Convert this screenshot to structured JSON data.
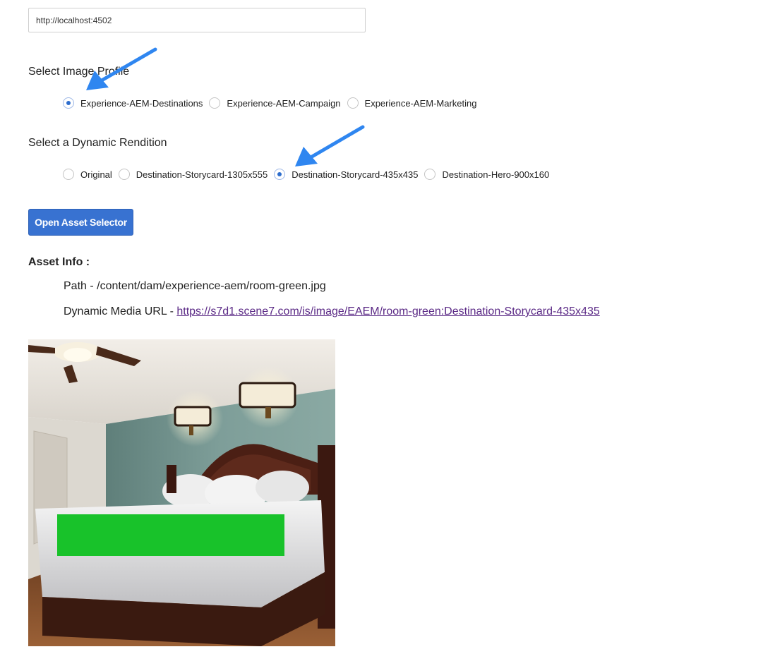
{
  "server": {
    "url_value": "http://localhost:4502"
  },
  "image_profile": {
    "label": "Select Image Profile",
    "options": [
      {
        "label": "Experience-AEM-Destinations",
        "checked": true
      },
      {
        "label": "Experience-AEM-Campaign",
        "checked": false
      },
      {
        "label": "Experience-AEM-Marketing",
        "checked": false
      }
    ]
  },
  "rendition": {
    "label": "Select a Dynamic Rendition",
    "options": [
      {
        "label": "Original",
        "checked": false
      },
      {
        "label": "Destination-Storycard-1305x555",
        "checked": false
      },
      {
        "label": "Destination-Storycard-435x435",
        "checked": true
      },
      {
        "label": "Destination-Hero-900x160",
        "checked": false
      }
    ]
  },
  "button": {
    "label": "Open Asset Selector"
  },
  "asset_info": {
    "title": "Asset Info :",
    "path_prefix": "Path - ",
    "path": "/content/dam/experience-aem/room-green.jpg",
    "url_prefix": "Dynamic Media URL - ",
    "url": "https://s7d1.scene7.com/is/image/EAEM/room-green:Destination-Storycard-435x435"
  },
  "colors": {
    "accent": "#3872d1",
    "annotation_arrow": "#2f86f0",
    "redaction": "#18c22a",
    "link": "#5b2a86"
  }
}
